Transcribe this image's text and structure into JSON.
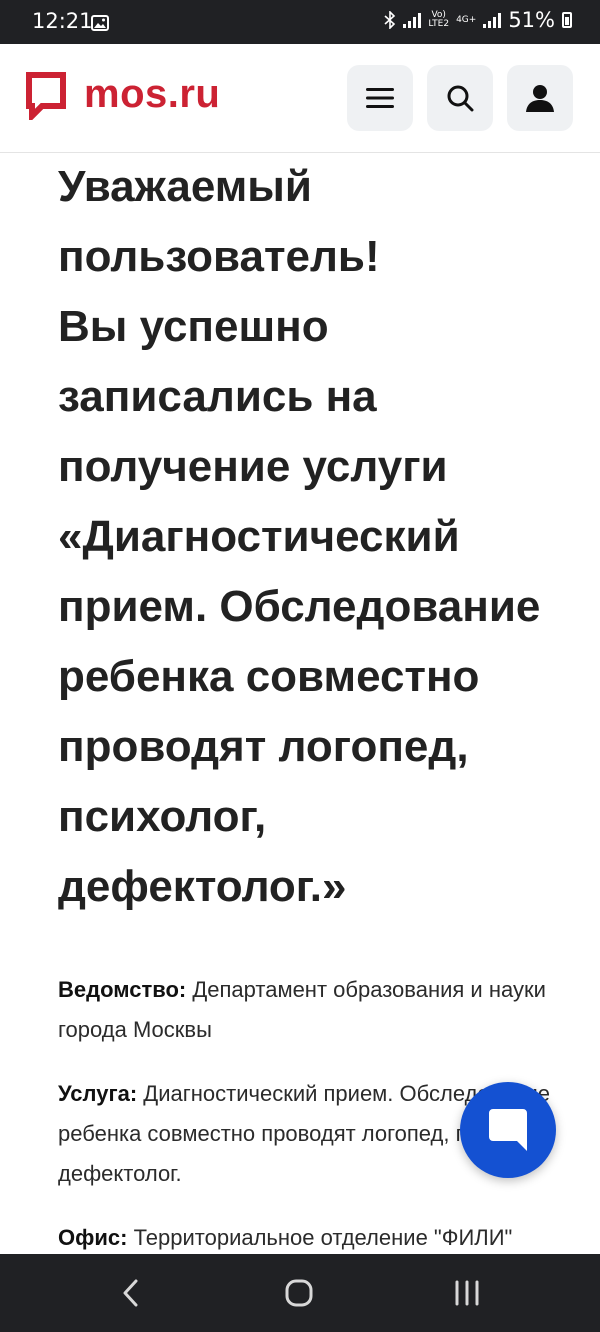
{
  "status_bar": {
    "time": "12:21",
    "network_label_top": "Vo)",
    "network_label_bottom": "LTE2",
    "network_type": "4G+",
    "battery": "51%"
  },
  "header": {
    "logo_text": "mos.ru",
    "brand_color": "#cc2233",
    "menu_icon": "hamburger-icon",
    "search_icon": "search-icon",
    "profile_icon": "user-icon"
  },
  "main": {
    "headline_line1": "Уважаемый пользователь!",
    "headline_line2": "Вы успешно записались на получение услуги «Диагностический прием. Обследование ребенка совместно проводят логопед, психолог, дефектолог.»",
    "info": [
      {
        "label": "Ведомство:",
        "value": " Департамент образования и науки города Москвы"
      },
      {
        "label": "Услуга:",
        "value": " Диагностический прием. Обследование ребенка совместно проводят логопед, психолог, дефектолог."
      },
      {
        "label": "Офис:",
        "value": " Территориальное отделение \"ФИЛИ\""
      }
    ]
  },
  "chat_button": {
    "icon": "chat-icon",
    "color": "#1451d2"
  },
  "nav_bar": {
    "back_icon": "back-icon",
    "home_icon": "home-icon",
    "recents_icon": "recents-icon"
  }
}
